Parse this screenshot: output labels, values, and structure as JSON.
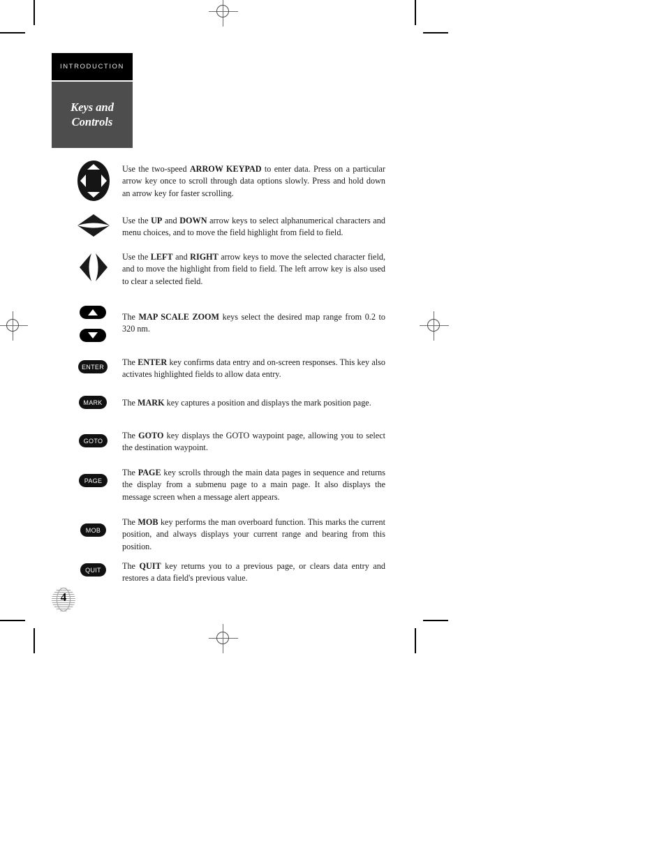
{
  "page": {
    "chapter_tab": "INTRODUCTION",
    "section_title_line1": "Keys and",
    "section_title_line2": "Controls",
    "page_number": "4",
    "globe_icon": "globe-icon"
  },
  "entries": [
    {
      "id": "arrow-keypad",
      "icon": "arrow-keypad-icon",
      "key_label": "",
      "text_html": "Use the two-speed <b>ARROW KEYPAD</b> to enter data. Press on a particular arrow key once to scroll through data options slowly. Press and hold down an arrow key for faster scrolling."
    },
    {
      "id": "up-down-arrows",
      "icon": "up-down-arrow-icon",
      "key_label": "",
      "text_html": "Use the <b>UP</b> and <b>DOWN</b> arrow keys to select alphanumerical characters and menu choices, and to move the field highlight from field to field."
    },
    {
      "id": "left-right-arrows",
      "icon": "left-right-arrow-icon",
      "key_label": "",
      "text_html": "Use the <b>LEFT</b> and <b>RIGHT</b> arrow keys to move the selected character field, and to move the highlight from field to field. The left arrow key is also used to clear a selected field."
    },
    {
      "id": "map-scale-zoom",
      "icon": "map-scale-zoom-icon",
      "key_label": "",
      "text_html": "The <b>MAP SCALE ZOOM</b> keys select the desired map range from 0.2 to 320 nm."
    },
    {
      "id": "enter",
      "icon": "enter-key-icon",
      "key_label": "ENTER",
      "text_html": "The <b>ENTER</b> key confirms data entry and on-screen responses. This key also activates highlighted fields to allow data entry."
    },
    {
      "id": "mark",
      "icon": "mark-key-icon",
      "key_label": "MARK",
      "text_html": "The <b>MARK</b> key captures a position and displays the mark position page."
    },
    {
      "id": "goto",
      "icon": "goto-key-icon",
      "key_label": "GOTO",
      "text_html": "The <b>GOTO</b> key displays the GOTO waypoint page, allowing you to select the destination waypoint."
    },
    {
      "id": "page",
      "icon": "page-key-icon",
      "key_label": "PAGE",
      "text_html": "The <b>PAGE</b> key scrolls through the main data pages in sequence and returns the display from a submenu page to a main page. It also displays the message screen when a message alert appears."
    },
    {
      "id": "mob",
      "icon": "mob-key-icon",
      "key_label": "MOB",
      "text_html": "The <b>MOB</b> key performs the man overboard function. This marks the current position, and always displays your current range and bearing from this position."
    },
    {
      "id": "quit",
      "icon": "quit-key-icon",
      "key_label": "QUIT",
      "text_html": "The <b>QUIT</b> key returns you to a previous page, or clears data entry and restores a data field's previous value."
    }
  ],
  "print_marks": {
    "registration_icon": "registration-mark-icon",
    "crop_icon": "crop-mark-icon"
  }
}
